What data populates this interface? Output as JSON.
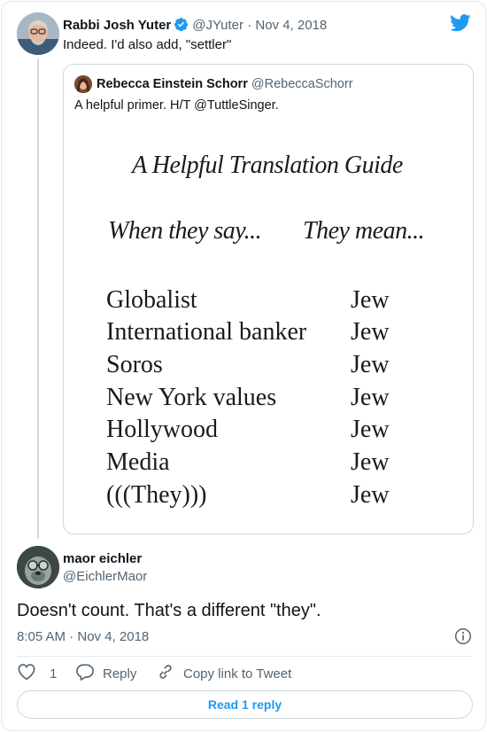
{
  "parent_tweet": {
    "author_name": "Rabbi Josh Yuter",
    "handle": "@JYuter",
    "separator": "·",
    "date": "Nov 4, 2018",
    "text": "Indeed. I'd also add, \"settler\"",
    "avatar_icon": "avatar-photo-man-glasses",
    "verified_icon": "verified-badge-icon"
  },
  "brand_icon": "twitter-bird-icon",
  "quoted_tweet": {
    "author_name": "Rebecca Einstein Schorr",
    "handle": "@RebeccaSchorr",
    "text": "A helpful primer. H/T @TuttleSinger.",
    "image": {
      "title": "A Helpful Translation Guide",
      "left_header": "When they say...",
      "right_header": "They mean...",
      "rows": [
        {
          "term": "Globalist",
          "meaning": "Jew"
        },
        {
          "term": "International banker",
          "meaning": "Jew"
        },
        {
          "term": "Soros",
          "meaning": "Jew"
        },
        {
          "term": "New York values",
          "meaning": "Jew"
        },
        {
          "term": "Hollywood",
          "meaning": "Jew"
        },
        {
          "term": "Media",
          "meaning": "Jew"
        },
        {
          "term": "(((They)))",
          "meaning": "Jew"
        }
      ]
    }
  },
  "reply_tweet": {
    "author_name": "maor eichler",
    "handle": "@EichlerMaor",
    "text": "Doesn't count. That's a different \"they\".",
    "timestamp": "8:05 AM · Nov 4, 2018"
  },
  "actions": {
    "like_count": "1",
    "reply_label": "Reply",
    "copy_link_label": "Copy link to Tweet"
  },
  "read_replies_label": "Read 1 reply",
  "colors": {
    "accent": "#1d9bf0",
    "muted_text": "#536471",
    "border": "#cfd9de"
  }
}
